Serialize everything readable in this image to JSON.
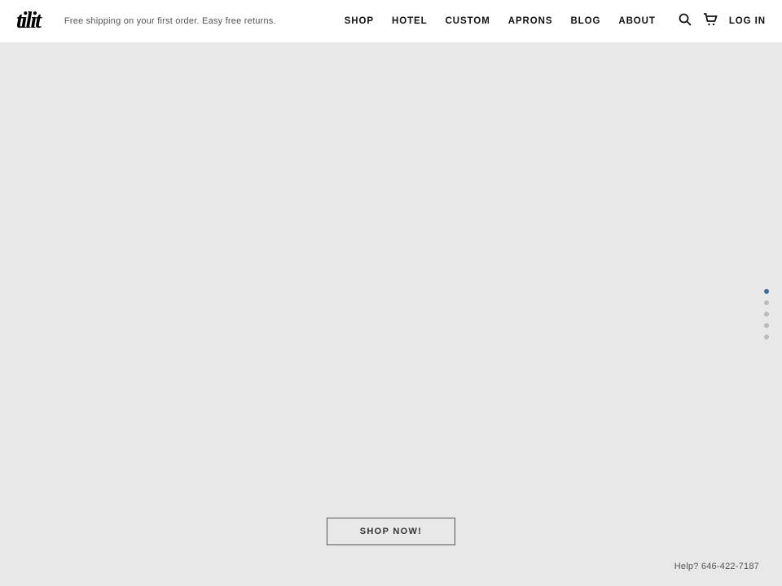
{
  "header": {
    "logo": "tilit",
    "tagline": "Free shipping on your first order. Easy free returns.",
    "nav": {
      "items": [
        {
          "id": "shop",
          "label": "SHOP"
        },
        {
          "id": "hotel",
          "label": "HOTEL"
        },
        {
          "id": "custom",
          "label": "CUSTOM"
        },
        {
          "id": "aprons",
          "label": "APRONS"
        },
        {
          "id": "blog",
          "label": "BLOG"
        },
        {
          "id": "about",
          "label": "ABOUT"
        }
      ],
      "log_in_label": "LOG IN"
    }
  },
  "main": {
    "shop_now_label": "SHOP NOW!",
    "help_text": "Help? 646-422-7187"
  },
  "slide_dots": {
    "count": 5,
    "active_index": 0
  }
}
